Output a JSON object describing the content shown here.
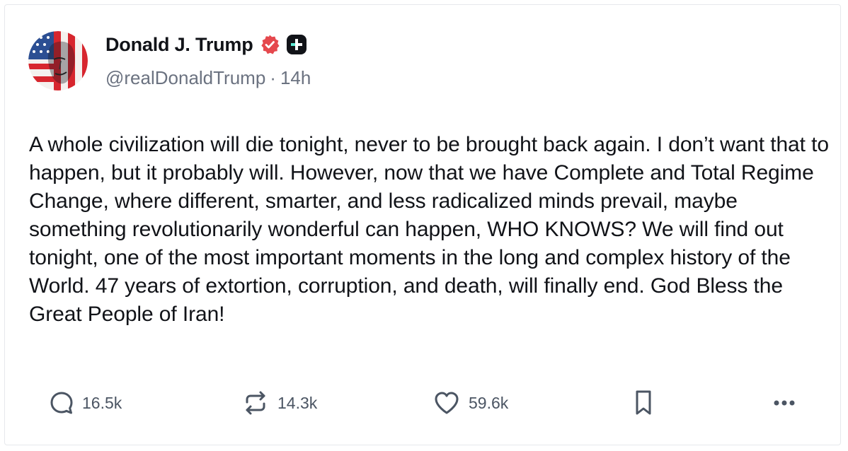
{
  "post": {
    "author": {
      "display_name": "Donald J. Trump",
      "handle": "@realDonaldTrump",
      "separator": "·",
      "time_ago": "14h",
      "verified_color": "#e5484d"
    },
    "text": "A whole civilization will die tonight, never to be brought back again. I don’t want that to happen, but it probably will. However, now that we have Complete and Total Regime Change, where different, smarter, and less radicalized minds prevail, maybe something revolutionarily wonderful can happen, WHO KNOWS? We will find out tonight, one of the most important moments in the long and complex history of the World. 47 years of extortion, corruption, and death, will finally end. God Bless the Great People of Iran!",
    "actions": {
      "reply_count": "16.5k",
      "repost_count": "14.3k",
      "like_count": "59.6k",
      "reply_icon": "speech-bubble-icon",
      "repost_icon": "repost-arrows-icon",
      "like_icon": "heart-icon",
      "bookmark_icon": "bookmark-icon",
      "more_icon": "more-dots-icon"
    }
  }
}
